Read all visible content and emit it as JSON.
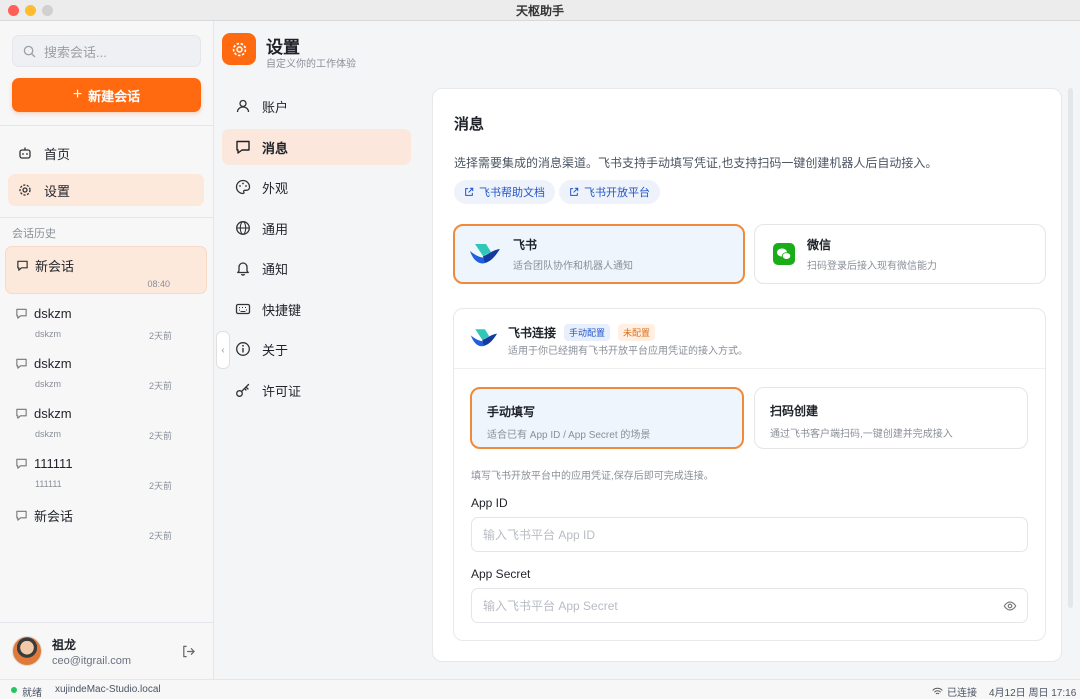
{
  "window": {
    "title": "天枢助手"
  },
  "sidebar": {
    "search_placeholder": "搜索会话...",
    "new_chat_label": "新建会话",
    "nav": [
      {
        "label": "首页",
        "icon": "robot-icon"
      },
      {
        "label": "设置",
        "icon": "gear-icon"
      }
    ],
    "history_label": "会话历史",
    "conversations": [
      {
        "title": "新会话",
        "subtitle": "",
        "time": "08:40"
      },
      {
        "title": "dskzm",
        "subtitle": "dskzm",
        "time": "2天前"
      },
      {
        "title": "dskzm",
        "subtitle": "dskzm",
        "time": "2天前"
      },
      {
        "title": "dskzm",
        "subtitle": "dskzm",
        "time": "2天前"
      },
      {
        "title": "111111",
        "subtitle": "111111",
        "time": "2天前"
      },
      {
        "title": "新会话",
        "subtitle": "",
        "time": "2天前"
      }
    ],
    "user": {
      "name": "祖龙",
      "email": "ceo@itgrail.com"
    }
  },
  "settings": {
    "title": "设置",
    "subtitle": "自定义你的工作体验",
    "nav": [
      {
        "label": "账户",
        "icon": "user-icon"
      },
      {
        "label": "消息",
        "icon": "message-icon"
      },
      {
        "label": "外观",
        "icon": "palette-icon"
      },
      {
        "label": "通用",
        "icon": "globe-icon"
      },
      {
        "label": "通知",
        "icon": "bell-icon"
      },
      {
        "label": "快捷键",
        "icon": "keyboard-icon"
      },
      {
        "label": "关于",
        "icon": "info-icon"
      },
      {
        "label": "许可证",
        "icon": "key-icon"
      }
    ]
  },
  "message": {
    "title": "消息",
    "description": "选择需要集成的消息渠道。飞书支持手动填写凭证,也支持扫码一键创建机器人后自动接入。",
    "links": [
      "飞书帮助文档",
      "飞书开放平台"
    ],
    "channels": [
      {
        "title": "飞书",
        "subtitle": "适合团队协作和机器人通知"
      },
      {
        "title": "微信",
        "subtitle": "扫码登录后接入现有微信能力"
      }
    ],
    "connection": {
      "title": "飞书连接",
      "tag_mode": "手动配置",
      "tag_status": "未配置",
      "subtitle": "适用于你已经拥有飞书开放平台应用凭证的接入方式。",
      "modes": [
        {
          "title": "手动填写",
          "subtitle": "适合已有 App ID / App Secret 的场景"
        },
        {
          "title": "扫码创建",
          "subtitle": "通过飞书客户端扫码,一键创建并完成接入"
        }
      ],
      "hint": "填写飞书开放平台中的应用凭证,保存后即可完成连接。",
      "app_id_label": "App ID",
      "app_id_placeholder": "输入飞书平台 App ID",
      "app_secret_label": "App Secret",
      "app_secret_placeholder": "输入飞书平台 App Secret"
    }
  },
  "status": {
    "ready": "就绪",
    "host": "xujindeMac-Studio.local",
    "connection": "已连接",
    "datetime": "4月12日 周日 17:16"
  },
  "colors": {
    "accent": "#ff6a10",
    "selected_border": "#f08a3a",
    "link": "#2456c9"
  }
}
